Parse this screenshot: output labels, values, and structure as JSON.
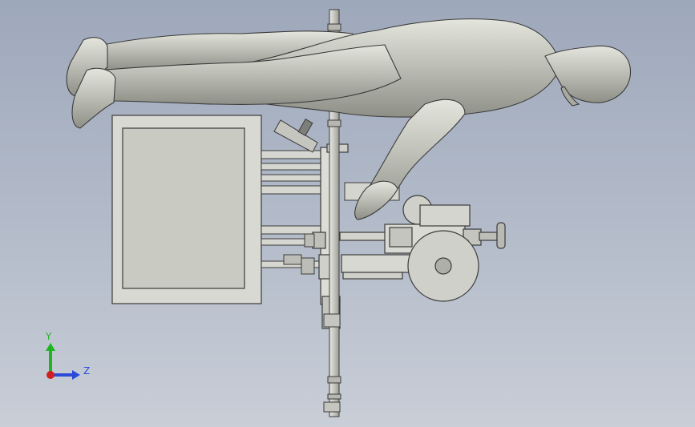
{
  "window": {
    "title": ""
  },
  "viewport": {
    "background_top": "#9ea8bb",
    "background_bottom": "#c9ced7",
    "view": "side view"
  },
  "model": {
    "body_color": "#c7c9c0",
    "frame_color": "#d9dad4",
    "edge_color": "#3b3b3b"
  },
  "triad": {
    "y_label": "Y",
    "z_label": "Z",
    "y_color": "#1fb51f",
    "z_color": "#2c49d8",
    "x_color": "#d01f1f"
  }
}
